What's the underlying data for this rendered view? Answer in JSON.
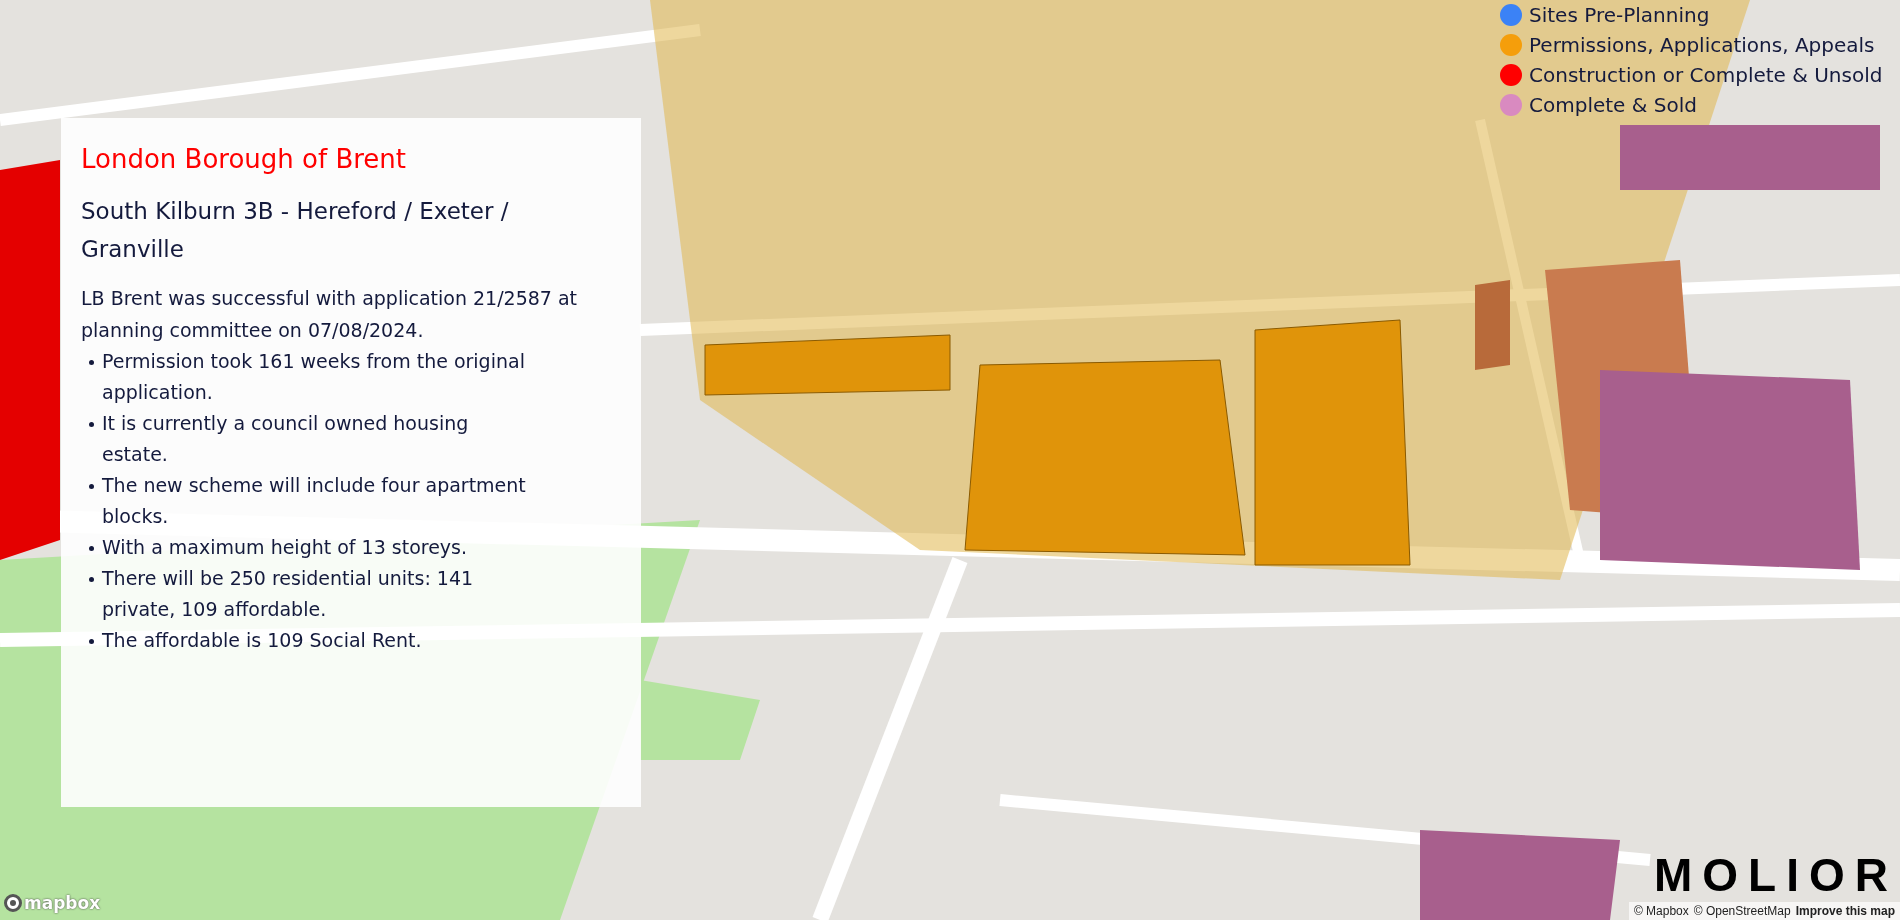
{
  "legend": [
    {
      "label": "Sites Pre-Planning",
      "color": "#3b82f6"
    },
    {
      "label": "Permissions, Applications, Appeals",
      "color": "#f59e0b"
    },
    {
      "label": "Construction or Complete & Unsold",
      "color": "#ff0000"
    },
    {
      "label": "Complete & Sold",
      "color": "#d98ac0"
    }
  ],
  "info_panel": {
    "borough": "London Borough of Brent",
    "site_title": "South Kilburn 3B - Hereford / Exeter / Granville",
    "summary": "LB Brent was successful with application 21/2587 at planning committee on 07/08/2024.",
    "bullets": [
      "Permission took 161 weeks from the original application.",
      "It is currently a council owned housing estate.",
      "The new scheme will include four apartment blocks.",
      "With a maximum height of 13 storeys.",
      "There will be 250 residential units: 141 private, 109 affordable.",
      "The affordable is 109 Social Rent."
    ]
  },
  "brand": "MOLIOR",
  "map_logo": "mapbox",
  "attribution": [
    "© Mapbox",
    "© OpenStreetMap",
    "Improve this map"
  ]
}
